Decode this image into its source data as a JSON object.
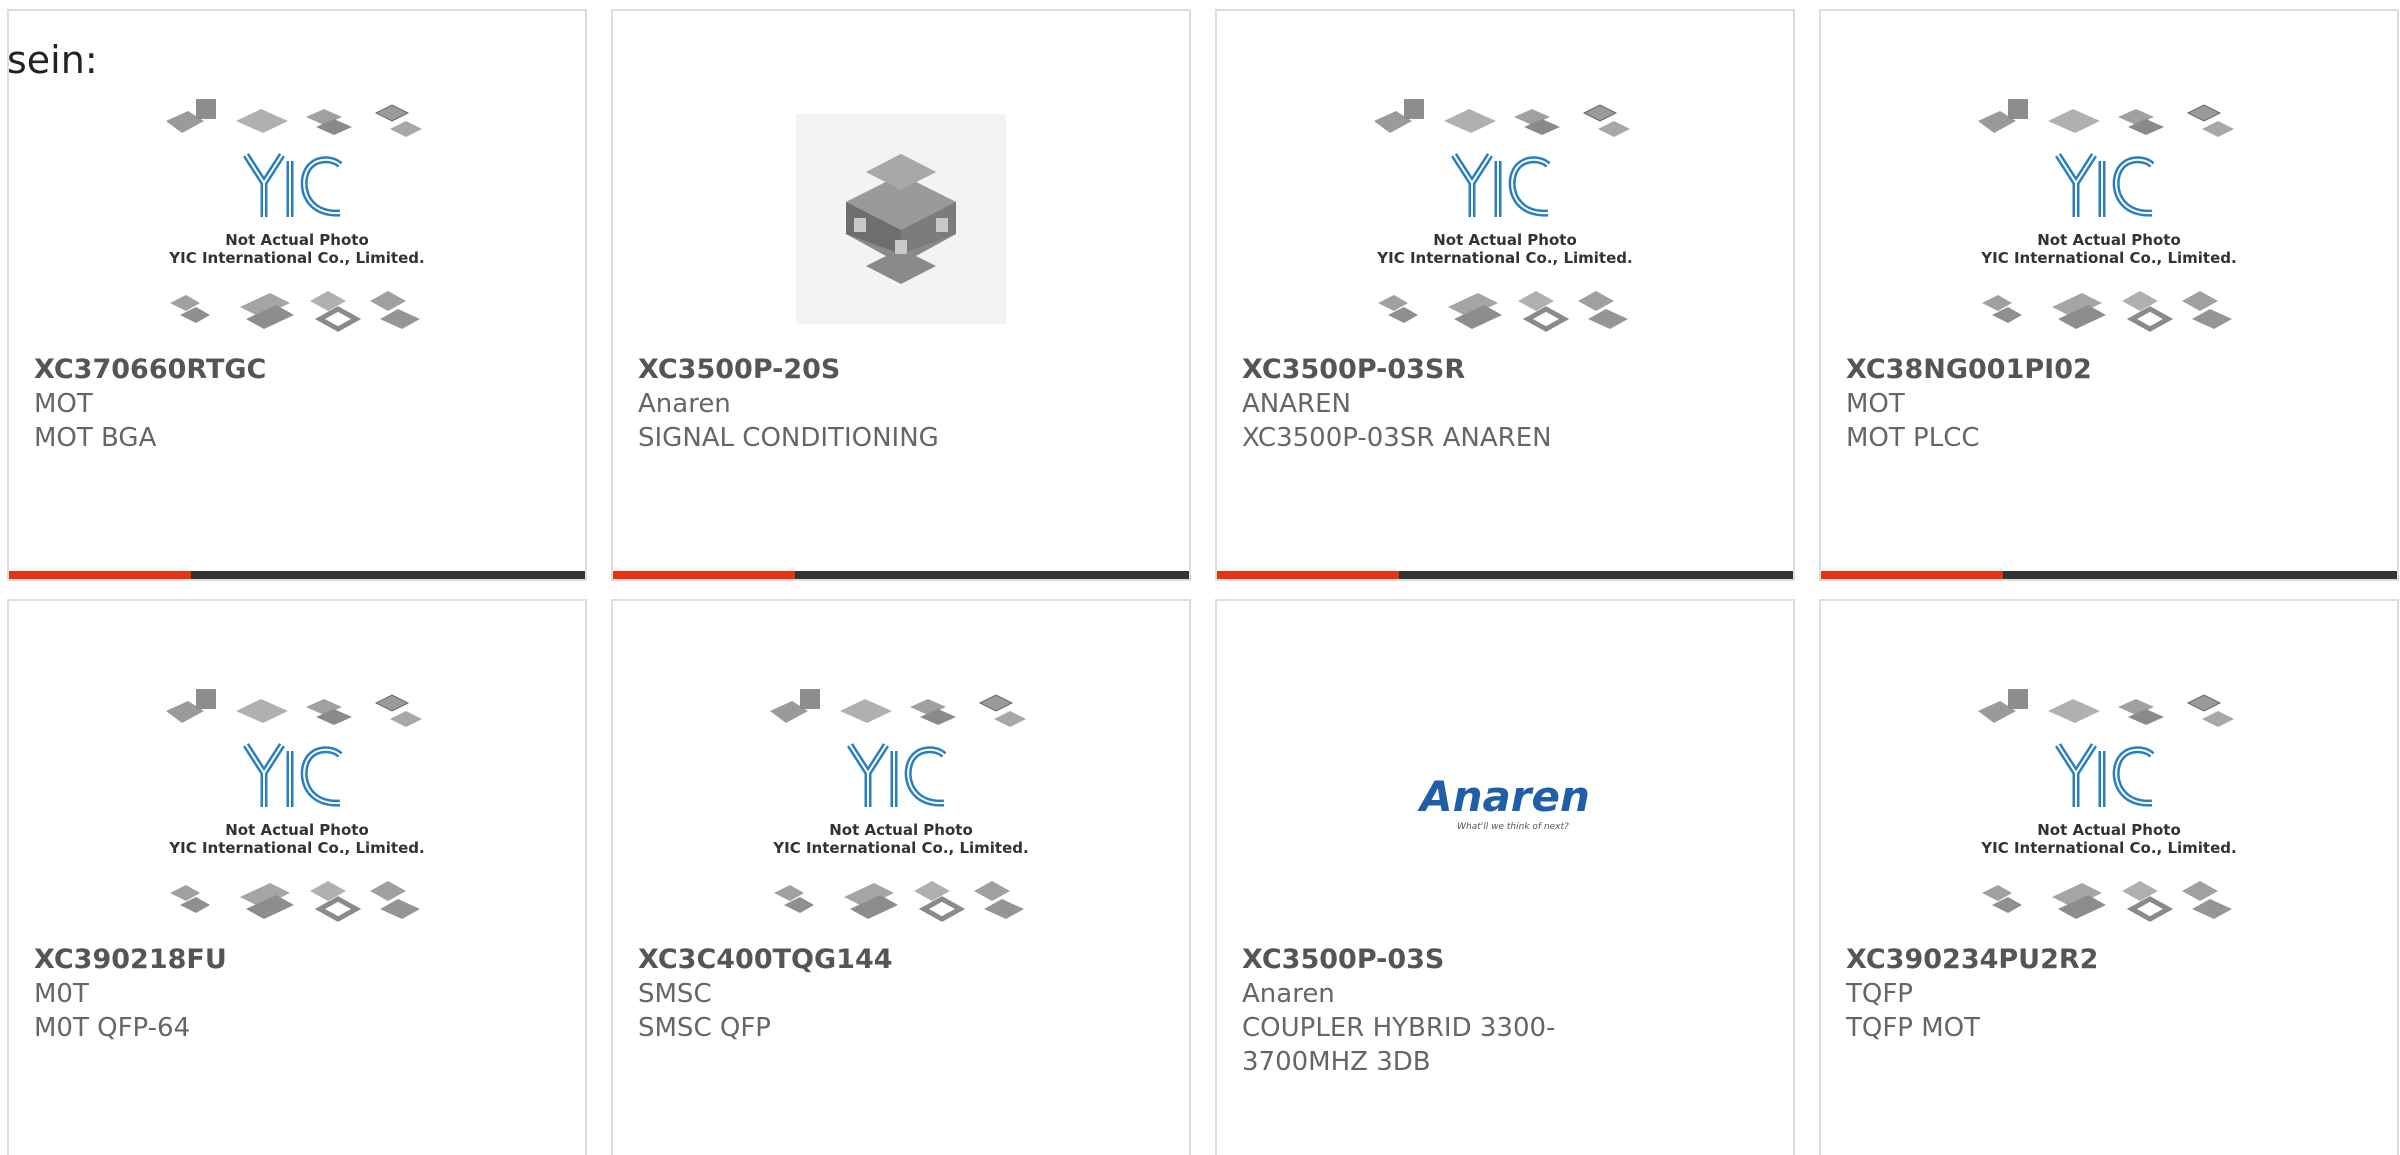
{
  "header": {
    "text": "sein:"
  },
  "placeholder": {
    "line1": "Not Actual Photo",
    "line2": "YIC International Co., Limited."
  },
  "anaren_logo": {
    "name": "Anaren",
    "tagline": "What'll we think of next?"
  },
  "colors": {
    "accent": "#e63312",
    "bar": "#333333",
    "border": "#dddddd",
    "logo_blue": "#2a7fc0"
  },
  "cards": [
    {
      "part": "XC370660RTGC",
      "maker": "MOT",
      "desc": "MOT BGA",
      "image": "yic-placeholder"
    },
    {
      "part": "XC3500P-20S",
      "maker": "Anaren",
      "desc": "SIGNAL CONDITIONING",
      "image": "chip-photo"
    },
    {
      "part": "XC3500P-03SR",
      "maker": "ANAREN",
      "desc": "XC3500P-03SR ANAREN",
      "image": "yic-placeholder"
    },
    {
      "part": "XC38NG001PI02",
      "maker": "MOT",
      "desc": "MOT PLCC",
      "image": "yic-placeholder"
    },
    {
      "part": "XC390218FU",
      "maker": "M0T",
      "desc": "M0T QFP-64",
      "image": "yic-placeholder"
    },
    {
      "part": "XC3C400TQG144",
      "maker": "SMSC",
      "desc": "SMSC QFP",
      "image": "yic-placeholder"
    },
    {
      "part": "XC3500P-03S",
      "maker": "Anaren",
      "desc": "COUPLER HYBRID 3300-3700MHZ 3DB",
      "image": "anaren-logo"
    },
    {
      "part": "XC390234PU2R2",
      "maker": "TQFP",
      "desc": "TQFP MOT",
      "image": "yic-placeholder"
    }
  ]
}
